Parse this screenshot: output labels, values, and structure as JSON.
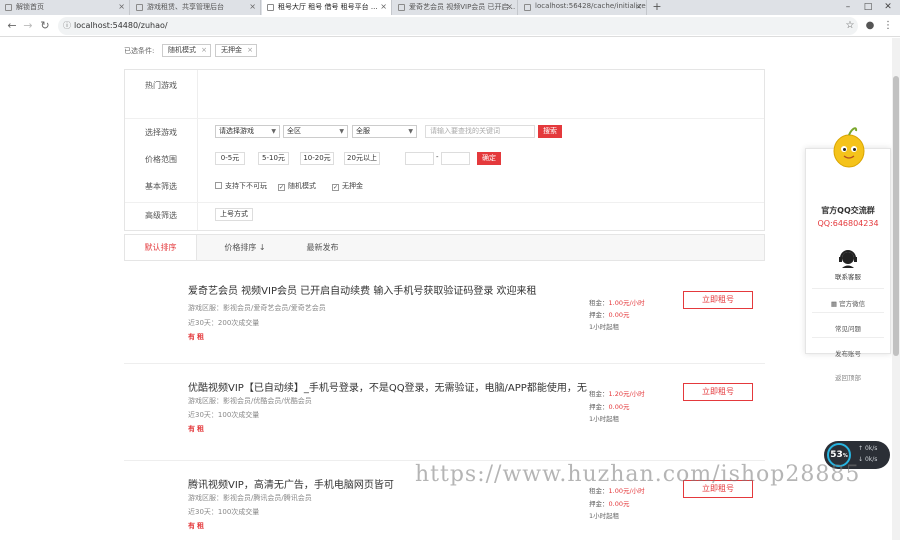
{
  "browser": {
    "tabs": [
      {
        "title": "解锁首页",
        "active": false
      },
      {
        "title": "游戏租赁、共享管理后台",
        "active": false
      },
      {
        "title": "租号大厅 租号 借号 租号平台 ...",
        "active": true
      },
      {
        "title": "爱奇艺会员 视频VIP会员 已开启...",
        "active": false
      },
      {
        "title": "localhost:56428/cache/initialize",
        "active": false
      }
    ],
    "new_tab": "+",
    "url": "localhost:54480/zuhao/",
    "controls": {
      "min": "–",
      "max": "□",
      "close": "✕"
    }
  },
  "selected": {
    "label": "已选条件:",
    "chips": [
      "随机模式",
      "无押金"
    ]
  },
  "filters": {
    "hot_label": "热门游戏",
    "game_label": "选择游戏",
    "game_select": "请选择游戏",
    "region_select": "全区",
    "server_select": "全服",
    "keyword_placeholder": "请输入要查找的关键词",
    "search_btn": "搜索",
    "price_label": "价格范围",
    "price_options": [
      "0-5元",
      "5-10元",
      "10-20元",
      "20元以上"
    ],
    "price_dash": "-",
    "price_confirm": "确定",
    "basic_label": "基本筛选",
    "basic_options": [
      {
        "label": "支持下不可玩",
        "checked": false
      },
      {
        "label": "随机模式",
        "checked": true
      },
      {
        "label": "无押金",
        "checked": true
      }
    ],
    "advanced_label": "高级筛选",
    "advanced_option": "上号方式"
  },
  "sort": {
    "items": [
      "默认排序",
      "价格排序 ↓",
      "最新发布"
    ]
  },
  "listings": [
    {
      "title": "爱奇艺会员 视频VIP会员 已开启自动续费 输入手机号获取验证码登录 欢迎来租",
      "area": "游戏区服：影视会员/爱奇艺会员/爱奇艺会员",
      "stats": "近30天：200次成交量",
      "tag": "有租",
      "rent_label": "租金：",
      "rent": "1.00元/小时",
      "deposit_label": "押金：",
      "deposit": "0.00元",
      "min": "1小时起租",
      "button": "立即租号"
    },
    {
      "title": "优酷视频VIP【已自动续】_手机号登录，不是QQ登录，无需验证，电脑/APP都能使用，无...",
      "area": "游戏区服：影视会员/优酷会员/优酷会员",
      "stats": "近30天：100次成交量",
      "tag": "有租",
      "rent_label": "租金：",
      "rent": "1.20元/小时",
      "deposit_label": "押金：",
      "deposit": "0.00元",
      "min": "1小时起租",
      "button": "立即租号"
    },
    {
      "title": "腾讯视频VIP，高清无广告，手机电脑网页皆可",
      "area": "游戏区服：影视会员/腾讯会员/腾讯会员",
      "stats": "近30天：100次成交量",
      "tag": "有租",
      "rent_label": "租金：",
      "rent": "1.00元/小时",
      "deposit_label": "押金：",
      "deposit": "0.00元",
      "min": "1小时起租",
      "button": "立即租号"
    }
  ],
  "qq_widget": {
    "title": "官方QQ交流群",
    "number": "QQ:646804234",
    "kefu": "联系客服",
    "links": [
      "官方微信",
      "常见问题",
      "发布账号",
      "返回顶部"
    ]
  },
  "speed_widget": {
    "value": "53",
    "unit": "%",
    "up": "0k/s",
    "down": "0k/s"
  },
  "watermark": "https://www.huzhan.com/ishop28885",
  "colors": {
    "accent": "#e4393c",
    "tab_strip": "#dee1e6"
  }
}
